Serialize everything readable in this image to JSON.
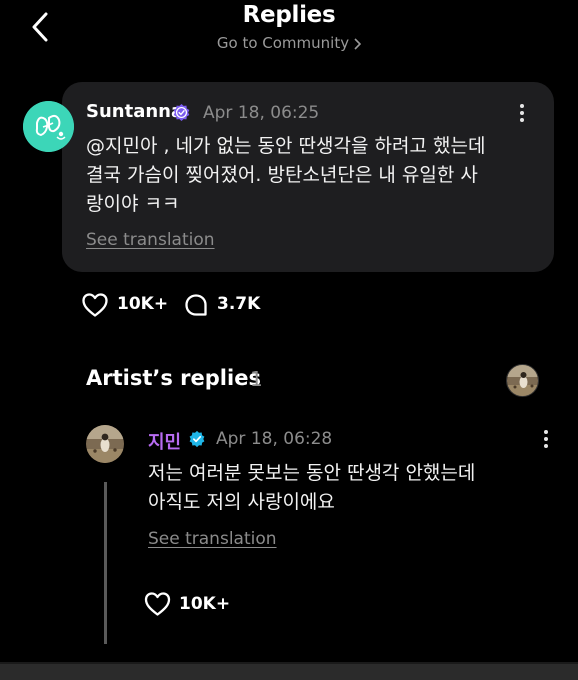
{
  "header": {
    "title": "Replies",
    "subtitle": "Go to Community"
  },
  "post": {
    "author": "Suntanna",
    "timestamp": "Apr 18, 06:25",
    "body": "@지민아 , 네가 없는 동안 딴생각을 하려고 했는데\n결국 가슴이 찢어졌어. 방탄소년단은 내 유일한 사\n랑이야 ㅋㅋ",
    "see_translation": "See translation",
    "likes": "10K+",
    "comments": "3.7K"
  },
  "artist_replies": {
    "title": "Artist’s replies",
    "count": "1",
    "reply": {
      "author": "지민",
      "timestamp": "Apr 18, 06:28",
      "body": "저는 여러분 못보는 동안 딴생각 안했는데\n아직도 저의 사랑이에요",
      "see_translation": "See translation",
      "likes": "10K+"
    }
  },
  "colors": {
    "background": "#000000",
    "card": "#1e1e20",
    "artist_name": "#b86cf2",
    "verified_purple": "#7b5cf0",
    "verified_blue": "#1fb6e8",
    "avatar_teal": "#3cd6b8"
  },
  "icons": [
    "back-icon",
    "chevron-right-icon",
    "verified-icon",
    "more-vertical-icon",
    "heart-icon",
    "comment-bubble-icon"
  ]
}
